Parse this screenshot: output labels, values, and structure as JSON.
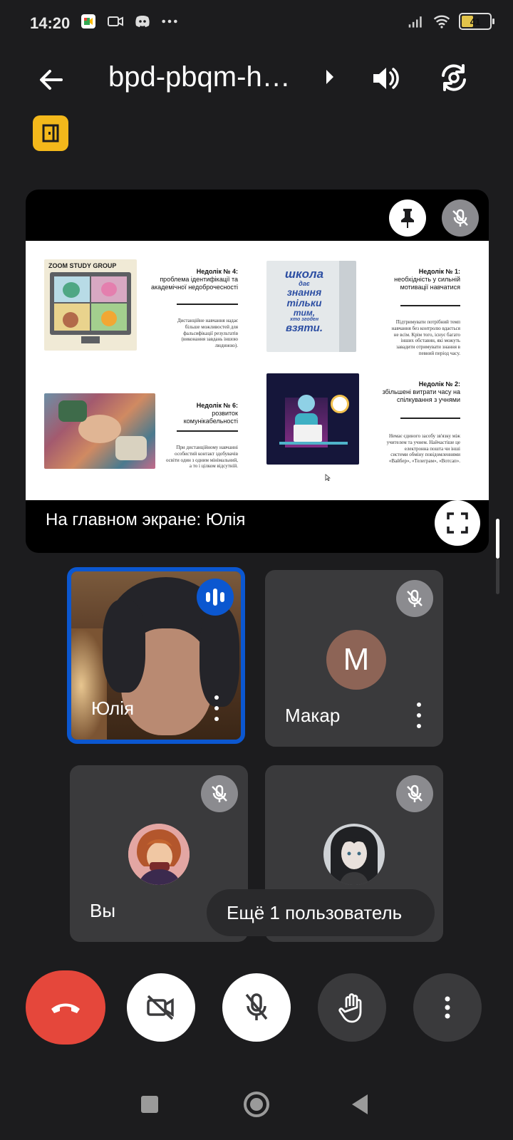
{
  "status_bar": {
    "time": "14:20",
    "battery_level": "41"
  },
  "header": {
    "meeting_code": "bpd-pbqm-h…"
  },
  "presentation": {
    "presenter_label": "На главном экране: Юлія",
    "slide": {
      "zoom_banner": "ZOOM STUDY GROUP",
      "poster_lines": [
        "школа",
        "дає",
        "знання",
        "тільки",
        "тим,",
        "хто згоден",
        "взяти."
      ],
      "blocks": [
        {
          "title": "Недолік № 4:",
          "subtitle": "проблема ідентифікації та академічної недоброчесності",
          "body": "Дистанційне навчання надає більше можливостей для фальсифікації результатів (виконання завдань іншою людиною)."
        },
        {
          "title": "Недолік № 1:",
          "subtitle": "необхідність у сильній мотивації навчатися",
          "body": "Підтримувати потрібний темп навчання без контролю вдається не всім. Крім того, існує багато інших обставин, які можуть завадити отримувати знання в певний період часу."
        },
        {
          "title": "Недолік № 6:",
          "subtitle": "розвиток комунікабельності",
          "body": "При дистанційному навчанні особистий контакт здобувачів освіти один з одним мінімальний, а то і цілком відсутній."
        },
        {
          "title": "Недолік № 2:",
          "subtitle": "збільшені витрати часу на спілкування з учнями",
          "body": "Немає єдиного засобу зв'язку між учителем та учнем. Найчастіше це електронна пошта чи інші системи обміну повідомленнями «Вайбер», «Телеграм», «Вотсап»."
        }
      ]
    }
  },
  "participants": [
    {
      "name": "Юлія",
      "speaking": true
    },
    {
      "name": "Макар",
      "avatar_letter": "M",
      "muted": true
    },
    {
      "name": "Вы",
      "muted": true
    },
    {
      "name": "",
      "muted": true
    }
  ],
  "more_users_label": "Ещё 1 пользователь",
  "colors": {
    "background": "#1c1c1e",
    "tile": "#3a3a3c",
    "active_border": "#0b57d0",
    "end_call": "#e5473b",
    "exit_badge": "#f3b81b"
  }
}
